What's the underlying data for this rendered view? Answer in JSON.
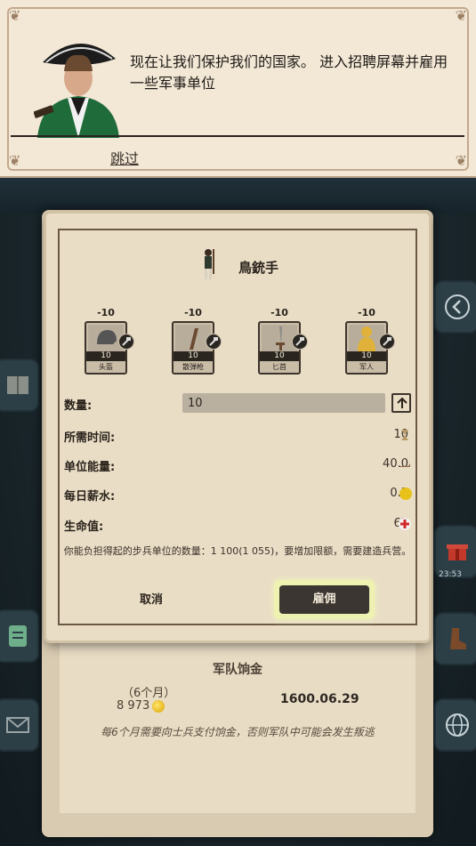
{
  "tutorial": {
    "message": "现在让我们保护我们的国家。 进入招聘屏幕并雇用一些军事单位",
    "skip_label": "跳过"
  },
  "dialog": {
    "unit_name": "鳥銃手",
    "equipment": [
      {
        "cost": "-10",
        "qty": "10",
        "name": "头盔",
        "icon": "helmet-icon"
      },
      {
        "cost": "-10",
        "qty": "10",
        "name": "散弹枪",
        "icon": "musket-icon"
      },
      {
        "cost": "-10",
        "qty": "10",
        "name": "匕首",
        "icon": "dagger-icon"
      },
      {
        "cost": "-10",
        "qty": "10",
        "name": "军人",
        "icon": "soldier-icon"
      }
    ],
    "quantity_label": "数量:",
    "quantity_value": "10",
    "time_label": "所需时间:",
    "time_value": "10",
    "energy_label": "单位能量:",
    "energy_value": "40.0",
    "salary_label": "每日薪水:",
    "salary_value": "0.5",
    "health_label": "生命值:",
    "health_value": "65",
    "info": "你能负担得起的步兵单位的数量：1 100(1 055)，要增加限额，需要建造兵营。",
    "cancel_label": "取消",
    "hire_label": "雇佣"
  },
  "background": {
    "army_wage_title": "军队饷金",
    "period": "（6个月）",
    "wage_amount": "8 973",
    "date": "1600.06.29",
    "note": "每6个月需要向士兵支付饷金，否则军队中可能会发生叛逃",
    "timer": "23:53"
  },
  "colors": {
    "parchment": "#e9ddc6",
    "dark_button": "#3b3632",
    "highlight": "#eef2b0",
    "ink": "#2a221b"
  }
}
